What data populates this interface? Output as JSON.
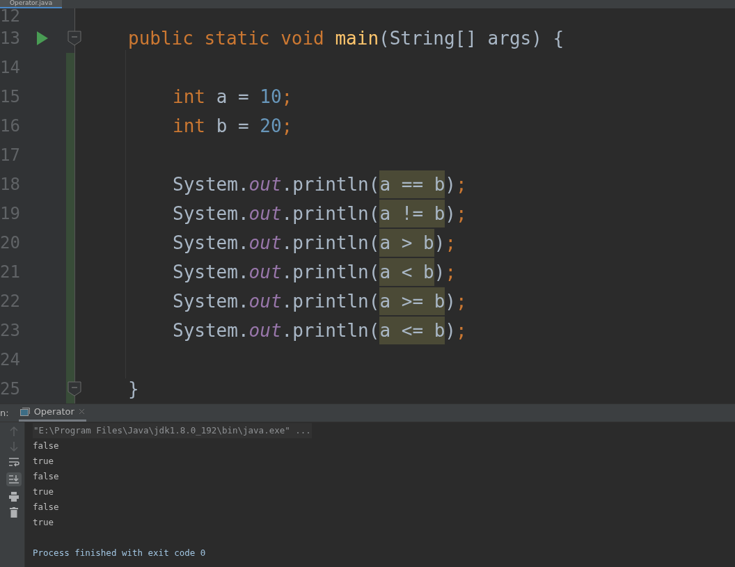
{
  "editor_tab": {
    "label": "Operator.java",
    "selected": true
  },
  "editor": {
    "lines": [
      {
        "number": "12",
        "run": false,
        "fold": false,
        "changed": false
      },
      {
        "number": "13",
        "run": true,
        "fold": true,
        "changed": false,
        "indented": false,
        "tokens": [
          {
            "kind": "keyword",
            "text": "public static void "
          },
          {
            "kind": "method",
            "text": "main"
          },
          {
            "kind": "plain",
            "text": "(String[] args) {"
          }
        ]
      },
      {
        "number": "14",
        "run": false,
        "fold": false,
        "changed": true
      },
      {
        "number": "15",
        "run": false,
        "fold": false,
        "changed": true,
        "indented": true,
        "tokens": [
          {
            "kind": "keyword",
            "text": "int "
          },
          {
            "kind": "plain",
            "text": "a = "
          },
          {
            "kind": "number",
            "text": "10"
          },
          {
            "kind": "keyword",
            "text": ";"
          }
        ]
      },
      {
        "number": "16",
        "run": false,
        "fold": false,
        "changed": true,
        "indented": true,
        "tokens": [
          {
            "kind": "keyword",
            "text": "int "
          },
          {
            "kind": "plain",
            "text": "b = "
          },
          {
            "kind": "number",
            "text": "20"
          },
          {
            "kind": "keyword",
            "text": ";"
          }
        ]
      },
      {
        "number": "17",
        "run": false,
        "fold": false,
        "changed": true
      },
      {
        "number": "18",
        "run": false,
        "fold": false,
        "changed": true,
        "indented": true,
        "tokens": [
          {
            "kind": "plain",
            "text": "System."
          },
          {
            "kind": "field",
            "text": "out"
          },
          {
            "kind": "plain",
            "text": ".println("
          },
          {
            "kind": "match",
            "text": "a == b"
          },
          {
            "kind": "plain",
            "text": ")"
          },
          {
            "kind": "keyword",
            "text": ";"
          }
        ]
      },
      {
        "number": "19",
        "run": false,
        "fold": false,
        "changed": true,
        "indented": true,
        "tokens": [
          {
            "kind": "plain",
            "text": "System."
          },
          {
            "kind": "field",
            "text": "out"
          },
          {
            "kind": "plain",
            "text": ".println("
          },
          {
            "kind": "match",
            "text": "a != b"
          },
          {
            "kind": "plain",
            "text": ")"
          },
          {
            "kind": "keyword",
            "text": ";"
          }
        ]
      },
      {
        "number": "20",
        "run": false,
        "fold": false,
        "changed": true,
        "indented": true,
        "tokens": [
          {
            "kind": "plain",
            "text": "System."
          },
          {
            "kind": "field",
            "text": "out"
          },
          {
            "kind": "plain",
            "text": ".println("
          },
          {
            "kind": "match",
            "text": "a > b"
          },
          {
            "kind": "plain",
            "text": ")"
          },
          {
            "kind": "keyword",
            "text": ";"
          }
        ]
      },
      {
        "number": "21",
        "run": false,
        "fold": false,
        "changed": true,
        "indented": true,
        "tokens": [
          {
            "kind": "plain",
            "text": "System."
          },
          {
            "kind": "field",
            "text": "out"
          },
          {
            "kind": "plain",
            "text": ".println("
          },
          {
            "kind": "match",
            "text": "a < b"
          },
          {
            "kind": "plain",
            "text": ")"
          },
          {
            "kind": "keyword",
            "text": ";"
          }
        ]
      },
      {
        "number": "22",
        "run": false,
        "fold": false,
        "changed": true,
        "indented": true,
        "tokens": [
          {
            "kind": "plain",
            "text": "System."
          },
          {
            "kind": "field",
            "text": "out"
          },
          {
            "kind": "plain",
            "text": ".println("
          },
          {
            "kind": "match",
            "text": "a >= b"
          },
          {
            "kind": "plain",
            "text": ")"
          },
          {
            "kind": "keyword",
            "text": ";"
          }
        ]
      },
      {
        "number": "23",
        "run": false,
        "fold": false,
        "changed": true,
        "indented": true,
        "tokens": [
          {
            "kind": "plain",
            "text": "System."
          },
          {
            "kind": "field",
            "text": "out"
          },
          {
            "kind": "plain",
            "text": ".println("
          },
          {
            "kind": "match",
            "text": "a <= b"
          },
          {
            "kind": "plain",
            "text": ")"
          },
          {
            "kind": "keyword",
            "text": ";"
          }
        ]
      },
      {
        "number": "24",
        "run": false,
        "fold": false,
        "changed": true
      },
      {
        "number": "25",
        "run": false,
        "fold": true,
        "changed": true,
        "indented": false,
        "tokens": [
          {
            "kind": "plain",
            "text": "}"
          }
        ]
      }
    ]
  },
  "run_panel": {
    "label": "n:",
    "tab": {
      "label": "Operator",
      "selected": true
    },
    "console": [
      {
        "kind": "command",
        "text": "\"E:\\Program Files\\Java\\jdk1.8.0_192\\bin\\java.exe\" ..."
      },
      {
        "kind": "output",
        "text": "false"
      },
      {
        "kind": "output",
        "text": "true"
      },
      {
        "kind": "output",
        "text": "false"
      },
      {
        "kind": "output",
        "text": "true"
      },
      {
        "kind": "output",
        "text": "false"
      },
      {
        "kind": "output",
        "text": "true"
      },
      {
        "kind": "blank"
      },
      {
        "kind": "system",
        "text": "Process finished with exit code 0"
      }
    ]
  }
}
